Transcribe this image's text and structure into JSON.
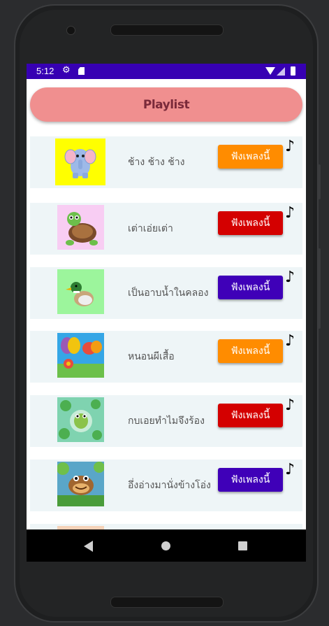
{
  "status_bar": {
    "time": "5:12"
  },
  "header": {
    "playlist_label": "Playlist"
  },
  "songs": [
    {
      "title": "ช้าง ช้าง ช้าง",
      "button_label": "ฟังเพลงนี้",
      "button_color": "#ff8c00",
      "thumb_bg": "#ffff00",
      "thumb_icon": "elephant-icon"
    },
    {
      "title": "เต่าเอ่ยเต่า",
      "button_label": "ฟังเพลงนี้",
      "button_color": "#d40000",
      "thumb_bg": "#f8cdf3",
      "thumb_icon": "turtle-icon"
    },
    {
      "title": "เป็นอาบน้ำในคลอง",
      "button_label": "ฟังเพลงนี้",
      "button_color": "#3f00b8",
      "thumb_bg": "#9cf59c",
      "thumb_icon": "duck-icon"
    },
    {
      "title": "หนอนผีเสื้อ",
      "button_label": "ฟังเพลงนี้",
      "button_color": "#ff8c00",
      "thumb_bg": "#35a6e6",
      "thumb_icon": "butterfly-icon"
    },
    {
      "title": "กบเอยทำไมจึงร้อง",
      "button_label": "ฟังเพลงนี้",
      "button_color": "#d40000",
      "thumb_bg": "#7fd3b0",
      "thumb_icon": "frog-icon"
    },
    {
      "title": "อึ่งอ่างมานั่งข้างโอ่ง",
      "button_label": "ฟังเพลงนี้",
      "button_color": "#3f00b8",
      "thumb_bg": "#5aa6c8",
      "thumb_icon": "toad-icon"
    }
  ],
  "colors": {
    "status_bar": "#3700b3",
    "playlist_button": "#f08f8f",
    "card_bg": "#eef5f7"
  }
}
